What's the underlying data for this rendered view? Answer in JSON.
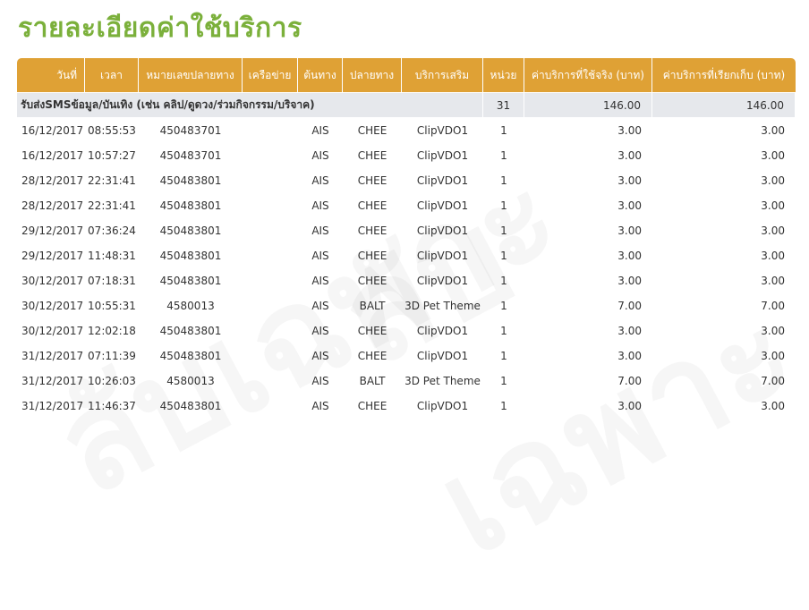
{
  "page_title": "รายละเอียดค่าใช้บริการ",
  "colors": {
    "title": "#7bb03b",
    "header_bg": "#dfa135",
    "group_bg": "#e6e8ec"
  },
  "watermark_text": "ลับเฉพาะ",
  "table": {
    "headers": [
      "วันที่",
      "เวลา",
      "หมายเลขปลายทาง",
      "เครือข่าย",
      "ต้นทาง",
      "ปลายทาง",
      "บริการเสริม",
      "หน่วย",
      "ค่าบริการที่ใช้จริง (บาท)",
      "ค่าบริการที่เรียกเก็บ (บาท)"
    ],
    "group": {
      "label": "รับส่งSMSข้อมูล/บันเทิง (เช่น คลิป/ดูดวง/ร่วมกิจกรรม/บริจาค)",
      "units": "31",
      "actual": "146.00",
      "charged": "146.00"
    },
    "rows": [
      [
        "16/12/2017",
        "08:55:53",
        "450483701",
        "",
        "AIS",
        "CHEE",
        "ClipVDO1",
        "1",
        "3.00",
        "3.00"
      ],
      [
        "16/12/2017",
        "10:57:27",
        "450483701",
        "",
        "AIS",
        "CHEE",
        "ClipVDO1",
        "1",
        "3.00",
        "3.00"
      ],
      [
        "28/12/2017",
        "22:31:41",
        "450483801",
        "",
        "AIS",
        "CHEE",
        "ClipVDO1",
        "1",
        "3.00",
        "3.00"
      ],
      [
        "28/12/2017",
        "22:31:41",
        "450483801",
        "",
        "AIS",
        "CHEE",
        "ClipVDO1",
        "1",
        "3.00",
        "3.00"
      ],
      [
        "29/12/2017",
        "07:36:24",
        "450483801",
        "",
        "AIS",
        "CHEE",
        "ClipVDO1",
        "1",
        "3.00",
        "3.00"
      ],
      [
        "29/12/2017",
        "11:48:31",
        "450483801",
        "",
        "AIS",
        "CHEE",
        "ClipVDO1",
        "1",
        "3.00",
        "3.00"
      ],
      [
        "30/12/2017",
        "07:18:31",
        "450483801",
        "",
        "AIS",
        "CHEE",
        "ClipVDO1",
        "1",
        "3.00",
        "3.00"
      ],
      [
        "30/12/2017",
        "10:55:31",
        "4580013",
        "",
        "AIS",
        "BALT",
        "3D Pet Theme",
        "1",
        "7.00",
        "7.00"
      ],
      [
        "30/12/2017",
        "12:02:18",
        "450483801",
        "",
        "AIS",
        "CHEE",
        "ClipVDO1",
        "1",
        "3.00",
        "3.00"
      ],
      [
        "31/12/2017",
        "07:11:39",
        "450483801",
        "",
        "AIS",
        "CHEE",
        "ClipVDO1",
        "1",
        "3.00",
        "3.00"
      ],
      [
        "31/12/2017",
        "10:26:03",
        "4580013",
        "",
        "AIS",
        "BALT",
        "3D Pet Theme",
        "1",
        "7.00",
        "7.00"
      ],
      [
        "31/12/2017",
        "11:46:37",
        "450483801",
        "",
        "AIS",
        "CHEE",
        "ClipVDO1",
        "1",
        "3.00",
        "3.00"
      ]
    ]
  }
}
